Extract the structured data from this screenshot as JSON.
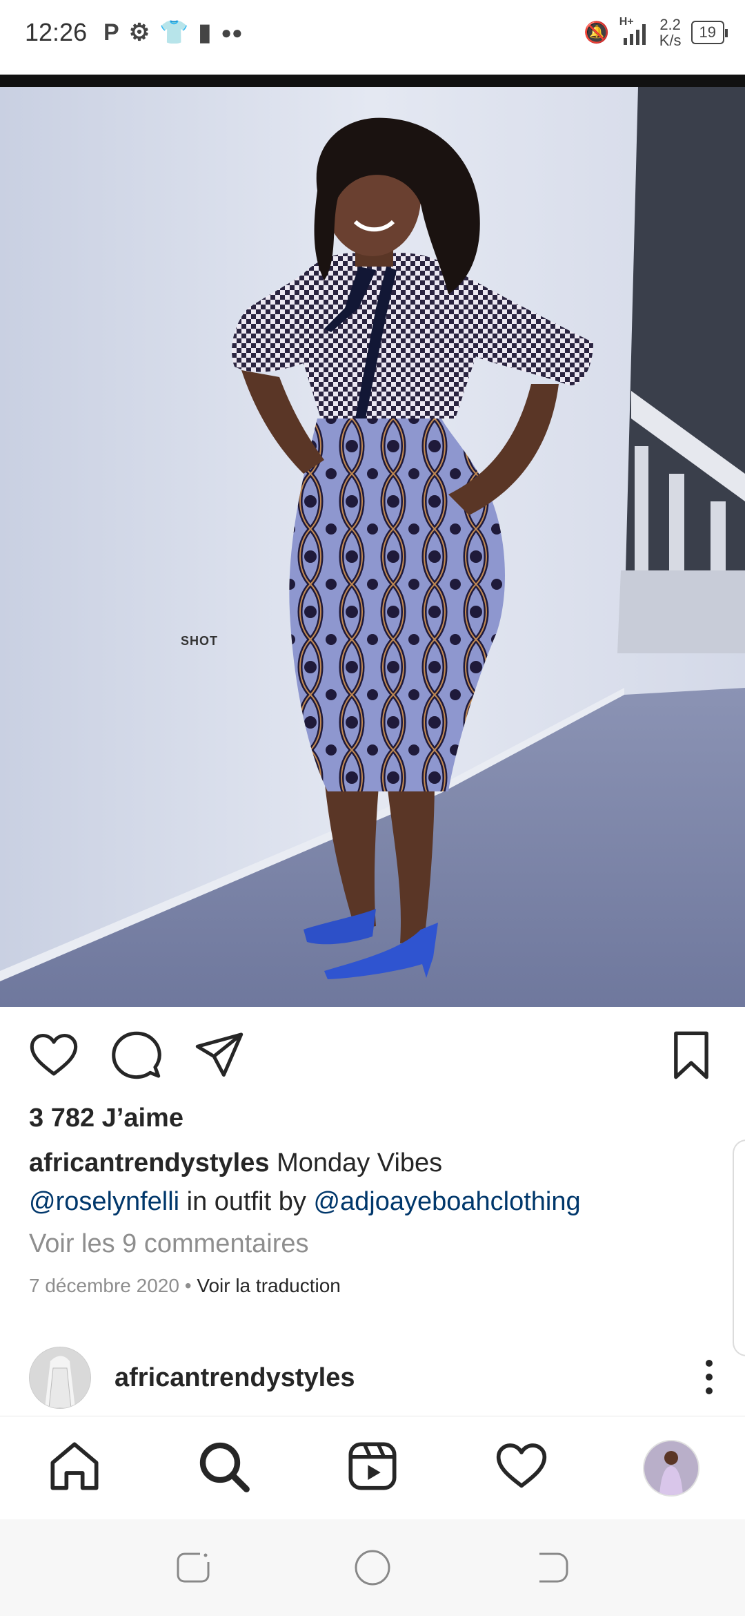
{
  "status_bar": {
    "time": "12:26",
    "net_speed_value": "2.2",
    "net_speed_unit": "K/s",
    "signal_label": "H+",
    "battery": "19"
  },
  "post": {
    "likes": "3 782 J’aime",
    "caption": {
      "username": "africantrendystyles",
      "text": "Monday Vibes",
      "mention_1": "@roselynfelli",
      "middle_text": "in outfit by",
      "mention_2": "@adjoayeboahclothing"
    },
    "view_comments": "Voir les 9 commentaires",
    "date": "7 décembre 2020",
    "separator": "•",
    "translate": "Voir la traduction",
    "photo_watermark": "SHOT"
  },
  "next_post": {
    "username": "africantrendystyles"
  },
  "icons": {
    "like": "heart-icon",
    "comment": "comment-icon",
    "share": "send-icon",
    "save": "bookmark-icon",
    "more": "more-vertical-icon",
    "nav_home": "home-icon",
    "nav_search": "search-icon",
    "nav_reels": "reels-icon",
    "nav_activity": "heart-icon",
    "nav_profile": "profile-avatar"
  },
  "colors": {
    "text": "#262626",
    "muted": "#8e8e8e",
    "mention": "#00376b"
  }
}
